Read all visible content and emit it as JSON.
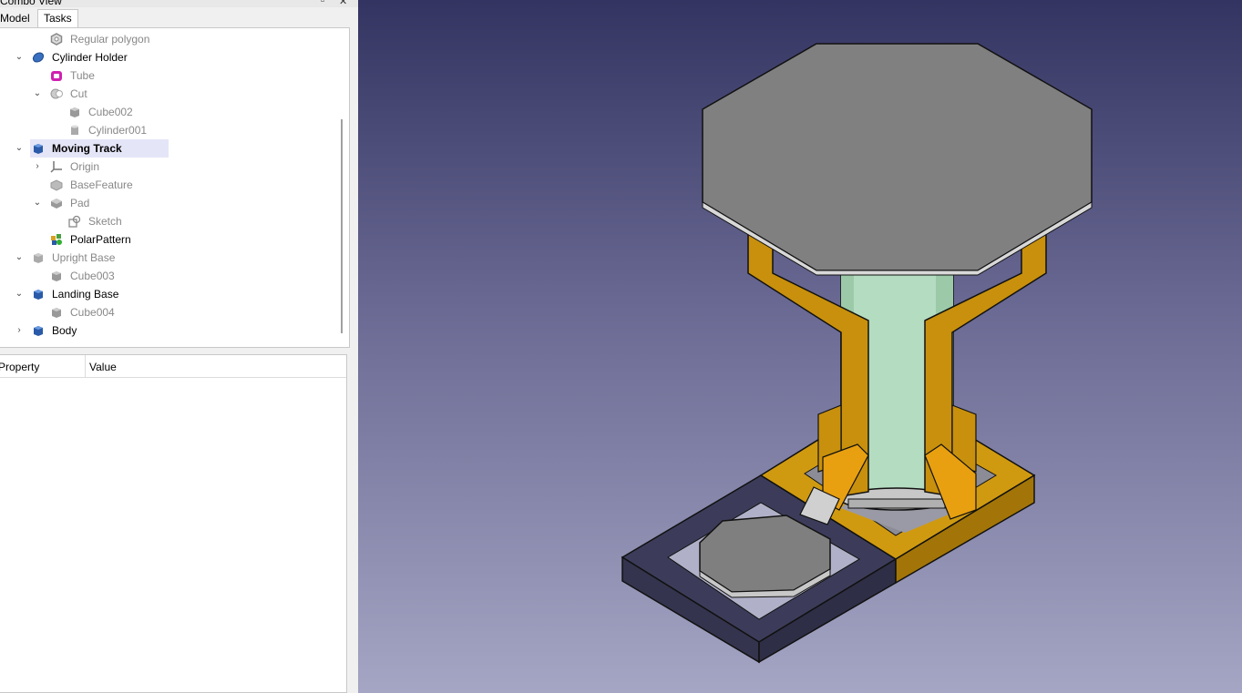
{
  "panel": {
    "title": "Combo View",
    "tabs": {
      "model": "Model",
      "tasks": "Tasks"
    }
  },
  "tree": {
    "items": [
      {
        "label": "Regular polygon",
        "icon": "regular-polygon-icon",
        "grey": true
      },
      {
        "label": "Cylinder Holder",
        "icon": "body-icon",
        "expanded": true
      },
      {
        "label": "Tube",
        "icon": "tube-icon",
        "grey": true
      },
      {
        "label": "Cut",
        "icon": "cut-icon",
        "grey": true,
        "expanded": true
      },
      {
        "label": "Cube002",
        "icon": "cube-icon",
        "grey": true
      },
      {
        "label": "Cylinder001",
        "icon": "cylinder-icon",
        "grey": true
      },
      {
        "label": "Moving Track",
        "icon": "body-icon",
        "bold": true,
        "selected": true,
        "expanded": true
      },
      {
        "label": "Origin",
        "icon": "origin-icon",
        "grey": true,
        "collapsed": true
      },
      {
        "label": "BaseFeature",
        "icon": "base-feature-icon",
        "grey": true
      },
      {
        "label": "Pad",
        "icon": "pad-icon",
        "grey": true,
        "expanded": true
      },
      {
        "label": "Sketch",
        "icon": "sketch-icon",
        "grey": true
      },
      {
        "label": "PolarPattern",
        "icon": "polar-pattern-icon"
      },
      {
        "label": "Upright Base",
        "icon": "cube-icon",
        "grey": true,
        "expanded": true
      },
      {
        "label": "Cube003",
        "icon": "cube-icon",
        "grey": true
      },
      {
        "label": "Landing Base",
        "icon": "body-icon",
        "expanded": true
      },
      {
        "label": "Cube004",
        "icon": "cube-icon",
        "grey": true
      },
      {
        "label": "Body",
        "icon": "body-icon",
        "collapsed": true
      }
    ]
  },
  "properties": {
    "columns": {
      "property": "Property",
      "value": "Value"
    }
  },
  "viewport": {
    "background_top": "#343462",
    "background_bottom": "#a5a5c4",
    "colors": {
      "octagon": "#808080",
      "bracket": "#c8900c",
      "cylinder": "#b4dcc0",
      "dark_frame": "#3c3c5a",
      "frame": "#d09a10"
    }
  }
}
